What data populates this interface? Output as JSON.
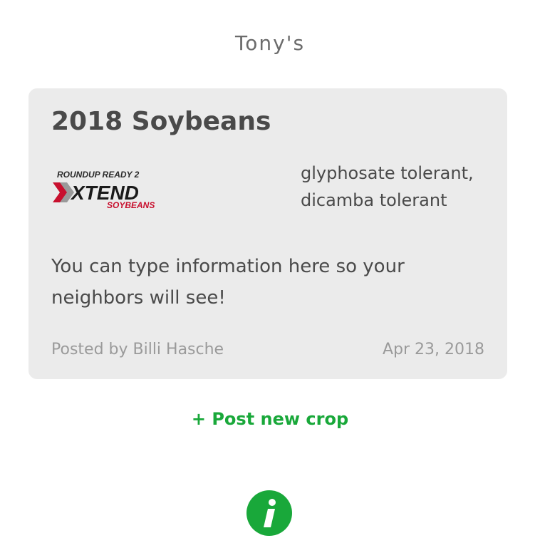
{
  "header": {
    "title": "Tony's"
  },
  "crop_card": {
    "title": "2018 Soybeans",
    "brand_logo": {
      "line1": "ROUNDUP READY 2",
      "line2": "XTEND",
      "line3": "SOYBEANS",
      "icon": "xtend-logo"
    },
    "traits": [
      "glyphosate tolerant,",
      "dicamba tolerant"
    ],
    "description": "You can type information here so your neighbors will see!",
    "posted_by": "Posted by Billi Hasche",
    "date": "Apr 23, 2018"
  },
  "actions": {
    "post_new_crop": "+ Post new crop",
    "info_icon": "info-icon"
  },
  "colors": {
    "accent_green": "#19a83a",
    "card_bg": "#ebebeb",
    "logo_red": "#c8102e"
  }
}
